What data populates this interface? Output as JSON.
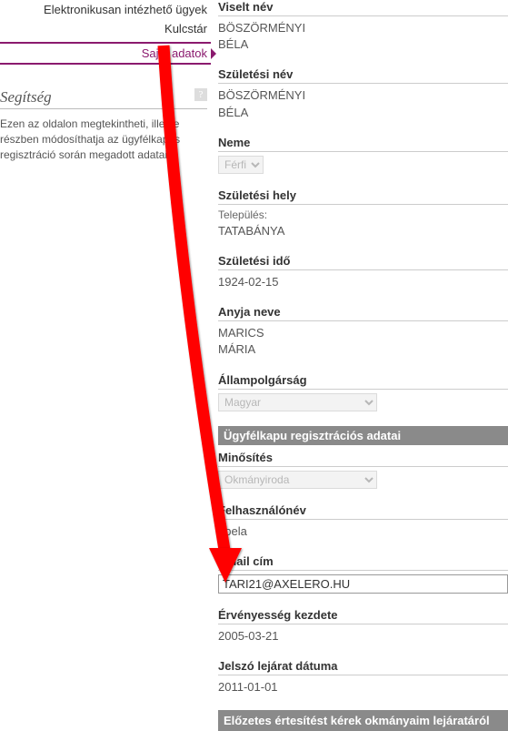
{
  "sidebar": {
    "nav": [
      {
        "label": "Elektronikusan intézhető ügyek"
      },
      {
        "label": "Kulcstár"
      },
      {
        "label": "Saját adatok",
        "active": true
      }
    ],
    "help_title": "Segítség",
    "help_text": "Ezen az oldalon megtekintheti, illetve részben módosíthatja az ügyfélkapus regisztráció során megadott adatait."
  },
  "fields": {
    "viselt_nev": {
      "label": "Viselt név",
      "value1": "BÖSZÖRMÉNYI",
      "value2": "BÉLA"
    },
    "szuletesi_nev": {
      "label": "Születési név",
      "value1": "BÖSZÖRMÉNYI",
      "value2": "BÉLA"
    },
    "neme": {
      "label": "Neme",
      "value": "Férfi"
    },
    "szuletesi_hely": {
      "label": "Születési hely",
      "sub": "Település:",
      "value": "TATABÁNYA"
    },
    "szuletesi_ido": {
      "label": "Születési idő",
      "value": "1924-02-15"
    },
    "anyja_neve": {
      "label": "Anyja neve",
      "value1": "MARICS",
      "value2": "MÁRIA"
    },
    "allampolgarsag": {
      "label": "Állampolgárság",
      "value": "Magyar"
    }
  },
  "reg_section": "Ügyfélkapu regisztrációs adatai",
  "reg": {
    "minosites": {
      "label": "Minősítés",
      "value": "Okmányiroda"
    },
    "felhasznalonev": {
      "label": "Felhasználónév",
      "value": "bbela"
    },
    "email": {
      "label": "Email cím",
      "value": "TARI21@AXELERO.HU"
    },
    "ervenyesseg": {
      "label": "Érvényesség kezdete",
      "value": "2005-03-21"
    },
    "jelszo_lejarat": {
      "label": "Jelszó lejárat dátuma",
      "value": "2011-01-01"
    }
  },
  "footer": "Előzetes értesítést kérek okmányaim lejáratáról"
}
